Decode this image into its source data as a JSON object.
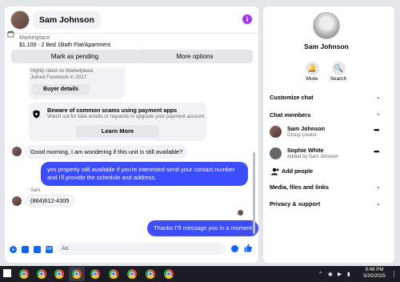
{
  "header": {
    "name": "Sam Johnson"
  },
  "marketplace": {
    "label": "Marketplace",
    "title": "$1,100 - 2 Bed 1Bath Flat/Apartment",
    "pending_button": "Mark as pending",
    "more_button": "More options"
  },
  "buyer_card": {
    "text_line1": "Highly rated on Marketplace",
    "text_line2": "Joined Facebook in 2017",
    "button": "Buyer details"
  },
  "scam_card": {
    "title": "Beware of common scams using payment apps",
    "subtitle": "Watch out for fake emails or requests to upgrade your payment account.",
    "button": "Learn More"
  },
  "messages": [
    {
      "from": "them",
      "text": "Good morning, I am wondering if this unit is still available?"
    },
    {
      "from": "me",
      "text": "yes property still available if you're interested send your contact number and I'll provide the schedule and address."
    },
    {
      "from": "them",
      "sender": "Sam",
      "text": "(864)612-4305"
    },
    {
      "from": "me",
      "text": "Thanks I''ll message you in a moment",
      "status": "Sent"
    }
  ],
  "composer": {
    "placeholder": "Aa"
  },
  "side": {
    "name": "Sam Johnson",
    "mute_label": "Mute",
    "search_label": "Search",
    "customize": "Customize chat",
    "members_title": "Chat members",
    "members": [
      {
        "name": "Sam Johnson",
        "sub": "Group creator"
      },
      {
        "name": "Sophie White",
        "sub": "Added by Sam Johnson"
      }
    ],
    "add_people": "Add people",
    "media": "Media, files and links",
    "privacy": "Privacy & support"
  },
  "taskbar": {
    "time": "9:46 PM",
    "date": "5/20/2025"
  },
  "colors": {
    "outgoing_bubble": "#3c4cff",
    "accent": "#0866ff",
    "info": "#a033ff"
  }
}
